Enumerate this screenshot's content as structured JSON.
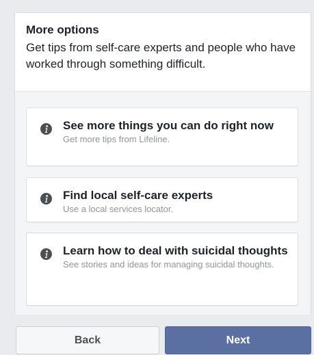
{
  "header": {
    "title": "More options",
    "description": "Get tips from self-care experts and people who have worked through something difficult."
  },
  "options": [
    {
      "title": "See more things you can do right now",
      "subtitle": "Get more tips from Lifeline.",
      "icon": "info-icon"
    },
    {
      "title": "Find local self-care experts",
      "subtitle": "Use a local services locator.",
      "icon": "info-icon"
    },
    {
      "title": "Learn how to deal with suicidal thoughts",
      "subtitle": "See stories and ideas for managing suicidal thoughts.",
      "icon": "info-icon"
    }
  ],
  "footer": {
    "back_label": "Back",
    "next_label": "Next"
  },
  "colors": {
    "primary_button": "#5b6fa3",
    "icon": "#4b4f56"
  }
}
